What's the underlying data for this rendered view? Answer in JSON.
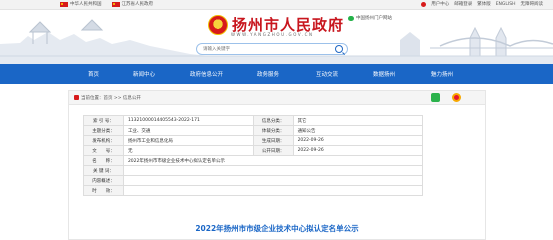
{
  "topbar": {
    "links": [
      "中华人民共和国",
      "江苏省人民政府"
    ],
    "right_items": [
      "用户中心",
      "邮箱登录",
      "繁体版",
      "ENGLISH",
      "无障碍阅读"
    ]
  },
  "banner": {
    "site_title": "扬州市人民政府",
    "site_url": "WWW.YANGZHOU.GOV.CN",
    "wechat_label": "中国扬州门户网站",
    "search_placeholder": "请输入关键字"
  },
  "nav": {
    "items": [
      "首页",
      "新闻中心",
      "政府信息公开",
      "政务服务",
      "互动交流",
      "数据扬州",
      "魅力扬州"
    ]
  },
  "breadcrumb": "当前位置：首页 >> 信息公开",
  "info_table": {
    "rows": [
      {
        "k1": "索 引 号：",
        "v1": "11321000014405543-2022-171",
        "k2": "信息分类：",
        "v2": "其它"
      },
      {
        "k1": "主题分类：",
        "v1": "工业、交通",
        "k2": "体裁分类：",
        "v2": "通知公告"
      },
      {
        "k1": "发布机构：",
        "v1": "扬州市工业和信息化局",
        "k2": "生成日期：",
        "v2": "2022-09-26"
      },
      {
        "k1": "文　　号：",
        "v1": "无",
        "k2": "公开日期：",
        "v2": "2022-09-26"
      }
    ],
    "name_label": "名　　称：",
    "name_value": "2022年扬州市市级企业技术中心拟认定名单公示",
    "keywords_label": "关 键 词：",
    "keywords_value": "",
    "summary_label": "内容概述：",
    "summary_value": "",
    "validity_label": "时　　效：",
    "validity_value": ""
  },
  "document_title": "2022年扬州市市级企业技术中心拟认定名单公示",
  "colors": {
    "brand_red": "#c8161e",
    "nav_blue": "#1a66c6"
  }
}
